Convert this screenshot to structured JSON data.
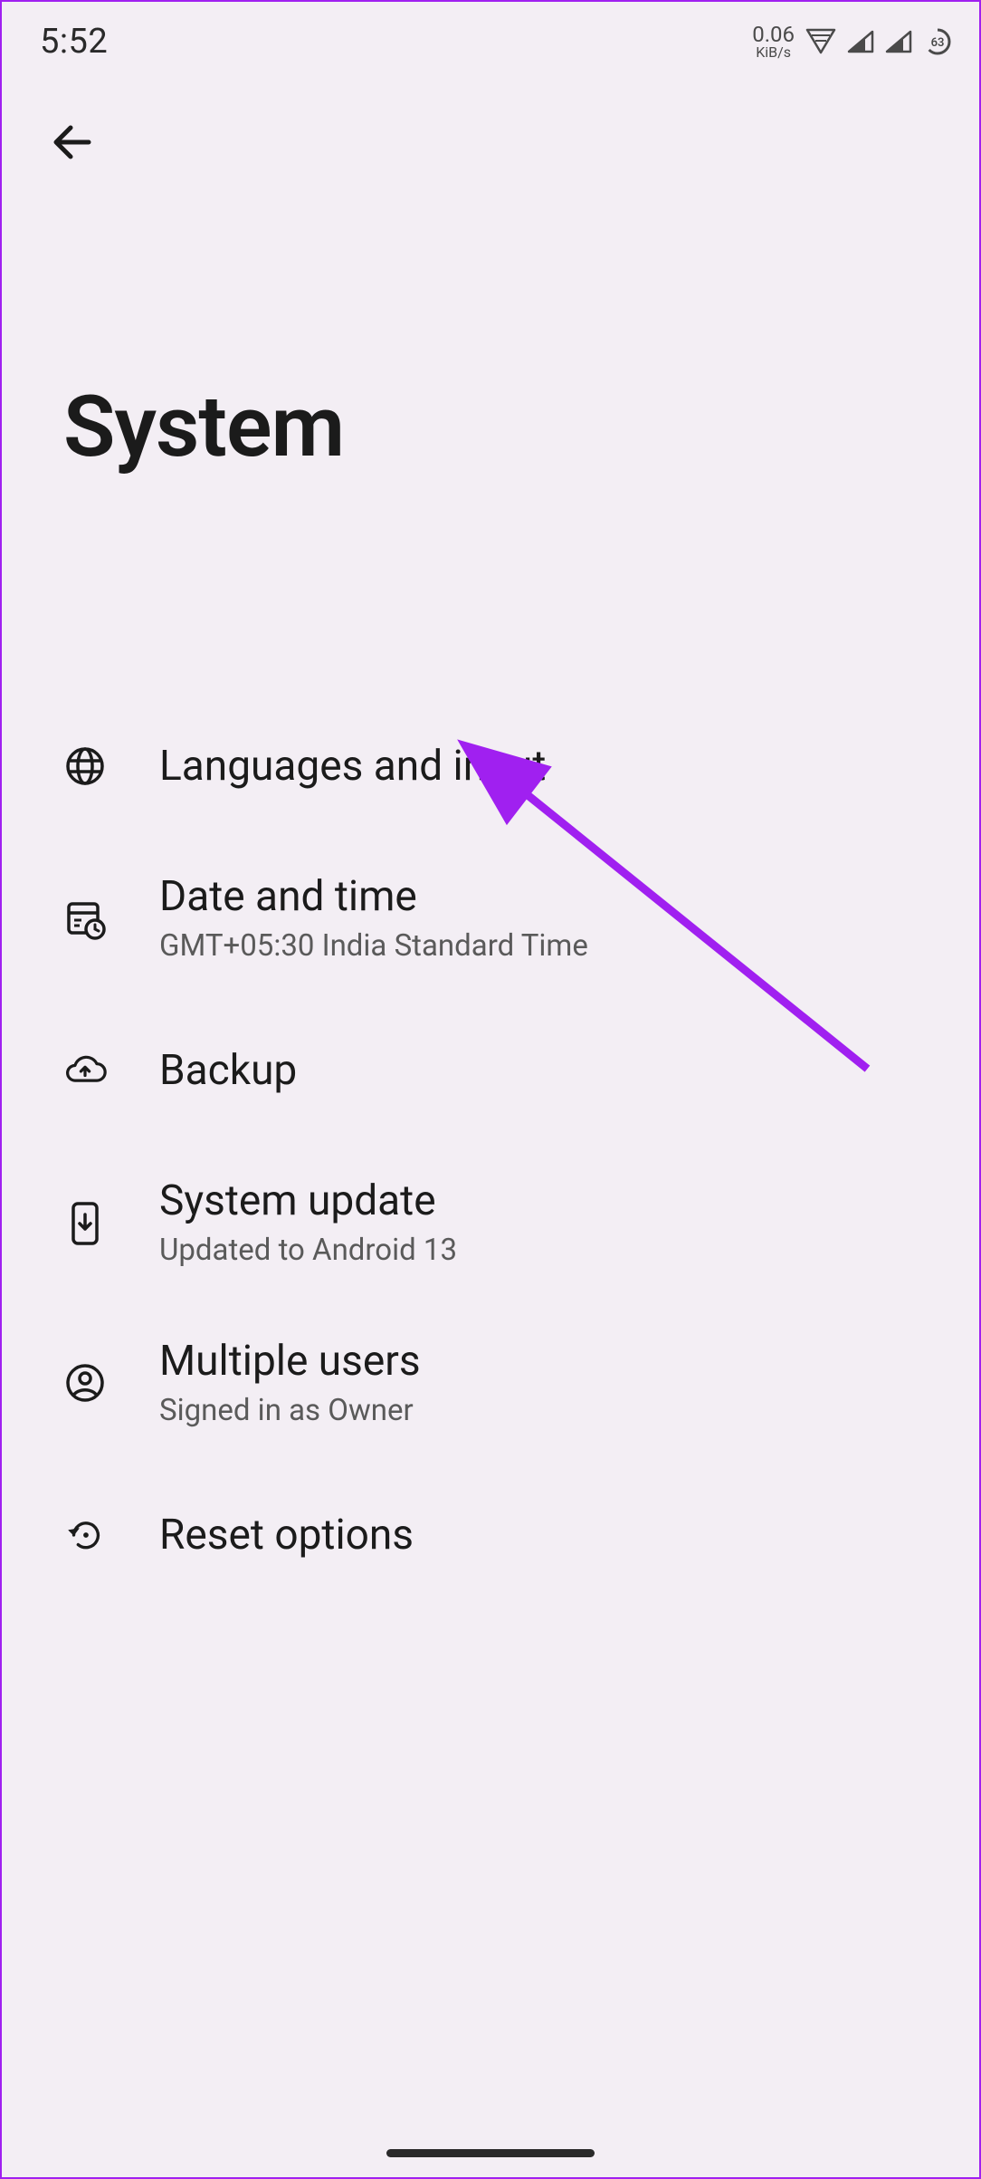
{
  "status": {
    "time": "5:52",
    "net_value": "0.06",
    "net_unit": "KiB/s",
    "battery_pct": "63"
  },
  "page": {
    "title": "System"
  },
  "items": [
    {
      "icon": "globe-icon",
      "title": "Languages and input",
      "subtitle": ""
    },
    {
      "icon": "calendar-clock-icon",
      "title": "Date and time",
      "subtitle": "GMT+05:30 India Standard Time"
    },
    {
      "icon": "cloud-upload-icon",
      "title": "Backup",
      "subtitle": ""
    },
    {
      "icon": "phone-download-icon",
      "title": "System update",
      "subtitle": "Updated to Android 13"
    },
    {
      "icon": "user-circle-icon",
      "title": "Multiple users",
      "subtitle": "Signed in as Owner"
    },
    {
      "icon": "reset-icon",
      "title": "Reset options",
      "subtitle": ""
    }
  ]
}
